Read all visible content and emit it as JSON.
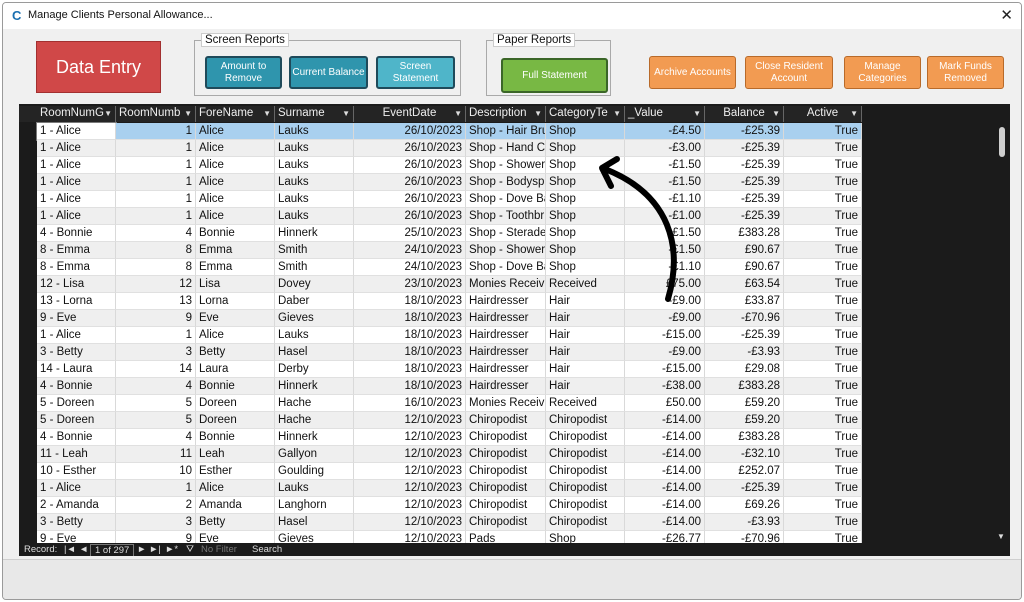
{
  "window": {
    "title": "Manage Clients Personal Allowance...",
    "logo": "C",
    "close": "✕"
  },
  "buttons": {
    "data_entry": "Data Entry",
    "amount_to_remove": "Amount to Remove",
    "current_balance": "Current Balance",
    "screen_statement": "Screen Statement",
    "full_statement": "Full Statement",
    "archive_accounts": "Archive Accounts",
    "close_resident_account": "Close Resident Account",
    "manage_categories": "Manage Categories",
    "mark_funds_removed": "Mark Funds Removed"
  },
  "groups": {
    "screen_reports": "Screen Reports",
    "paper_reports": "Paper Reports"
  },
  "columns": [
    "RoomNumG",
    "RoomNumb",
    "ForeName",
    "Surname",
    "EventDate",
    "Description",
    "CategoryTe",
    "_Value",
    "Balance",
    "Active"
  ],
  "rows": [
    [
      "1 - Alice",
      "1",
      "Alice",
      "Lauks",
      "26/10/2023",
      "Shop - Hair Bru",
      "Shop",
      "-£4.50",
      "-£25.39",
      "True"
    ],
    [
      "1 - Alice",
      "1",
      "Alice",
      "Lauks",
      "26/10/2023",
      "Shop - Hand Cr",
      "Shop",
      "-£3.00",
      "-£25.39",
      "True"
    ],
    [
      "1 - Alice",
      "1",
      "Alice",
      "Lauks",
      "26/10/2023",
      "Shop -  Shower",
      "Shop",
      "-£1.50",
      "-£25.39",
      "True"
    ],
    [
      "1 - Alice",
      "1",
      "Alice",
      "Lauks",
      "26/10/2023",
      "Shop - Bodyspr",
      "Shop",
      "-£1.50",
      "-£25.39",
      "True"
    ],
    [
      "1 - Alice",
      "1",
      "Alice",
      "Lauks",
      "26/10/2023",
      "Shop - Dove Ba",
      "Shop",
      "-£1.10",
      "-£25.39",
      "True"
    ],
    [
      "1 - Alice",
      "1",
      "Alice",
      "Lauks",
      "26/10/2023",
      "Shop - Toothbr",
      "Shop",
      "-£1.00",
      "-£25.39",
      "True"
    ],
    [
      "4 - Bonnie",
      "4",
      "Bonnie",
      "Hinnerk",
      "25/10/2023",
      "Shop - Sterade",
      "Shop",
      "-£1.50",
      "£383.28",
      "True"
    ],
    [
      "8 - Emma",
      "8",
      "Emma",
      "Smith",
      "24/10/2023",
      "Shop -  Shower",
      "Shop",
      "-£1.50",
      "£90.67",
      "True"
    ],
    [
      "8 - Emma",
      "8",
      "Emma",
      "Smith",
      "24/10/2023",
      "Shop - Dove Ba",
      "Shop",
      "-£1.10",
      "£90.67",
      "True"
    ],
    [
      "12 - Lisa",
      "12",
      "Lisa",
      "Dovey",
      "23/10/2023",
      "Monies Receiv",
      "Received",
      "£75.00",
      "£63.54",
      "True"
    ],
    [
      "13 - Lorna",
      "13",
      "Lorna",
      "Daber",
      "18/10/2023",
      "Hairdresser",
      "Hair",
      "-£9.00",
      "£33.87",
      "True"
    ],
    [
      "9 - Eve",
      "9",
      "Eve",
      "Gieves",
      "18/10/2023",
      "Hairdresser",
      "Hair",
      "-£9.00",
      "-£70.96",
      "True"
    ],
    [
      "1 - Alice",
      "1",
      "Alice",
      "Lauks",
      "18/10/2023",
      "Hairdresser",
      "Hair",
      "-£15.00",
      "-£25.39",
      "True"
    ],
    [
      "3 - Betty",
      "3",
      "Betty",
      "Hasel",
      "18/10/2023",
      "Hairdresser",
      "Hair",
      "-£9.00",
      "-£3.93",
      "True"
    ],
    [
      "14 - Laura",
      "14",
      "Laura",
      "Derby",
      "18/10/2023",
      "Hairdresser",
      "Hair",
      "-£15.00",
      "£29.08",
      "True"
    ],
    [
      "4 - Bonnie",
      "4",
      "Bonnie",
      "Hinnerk",
      "18/10/2023",
      "Hairdresser",
      "Hair",
      "-£38.00",
      "£383.28",
      "True"
    ],
    [
      "5 - Doreen",
      "5",
      "Doreen",
      "Hache",
      "16/10/2023",
      "Monies Receiv",
      "Received",
      "£50.00",
      "£59.20",
      "True"
    ],
    [
      "5 - Doreen",
      "5",
      "Doreen",
      "Hache",
      "12/10/2023",
      "Chiropodist",
      "Chiropodist",
      "-£14.00",
      "£59.20",
      "True"
    ],
    [
      "4 - Bonnie",
      "4",
      "Bonnie",
      "Hinnerk",
      "12/10/2023",
      "Chiropodist",
      "Chiropodist",
      "-£14.00",
      "£383.28",
      "True"
    ],
    [
      "11 - Leah",
      "11",
      "Leah",
      "Gallyon",
      "12/10/2023",
      "Chiropodist",
      "Chiropodist",
      "-£14.00",
      "-£32.10",
      "True"
    ],
    [
      "10 - Esther",
      "10",
      "Esther",
      "Goulding",
      "12/10/2023",
      "Chiropodist",
      "Chiropodist",
      "-£14.00",
      "£252.07",
      "True"
    ],
    [
      "1 - Alice",
      "1",
      "Alice",
      "Lauks",
      "12/10/2023",
      "Chiropodist",
      "Chiropodist",
      "-£14.00",
      "-£25.39",
      "True"
    ],
    [
      "2 - Amanda",
      "2",
      "Amanda",
      "Langhorn",
      "12/10/2023",
      "Chiropodist",
      "Chiropodist",
      "-£14.00",
      "£69.26",
      "True"
    ],
    [
      "3 - Betty",
      "3",
      "Betty",
      "Hasel",
      "12/10/2023",
      "Chiropodist",
      "Chiropodist",
      "-£14.00",
      "-£3.93",
      "True"
    ],
    [
      "9 - Eve",
      "9",
      "Eve",
      "Gieves",
      "12/10/2023",
      "Pads",
      "Shop",
      "-£26.77",
      "-£70.96",
      "True"
    ]
  ],
  "navigation": {
    "record_label": "Record:",
    "record_position": "1 of 297",
    "no_filter": "No Filter",
    "search": "Search"
  },
  "colors": {
    "selected_row": "#a9d0ef",
    "alt_row": "#efefef",
    "annotation": "#000000"
  }
}
